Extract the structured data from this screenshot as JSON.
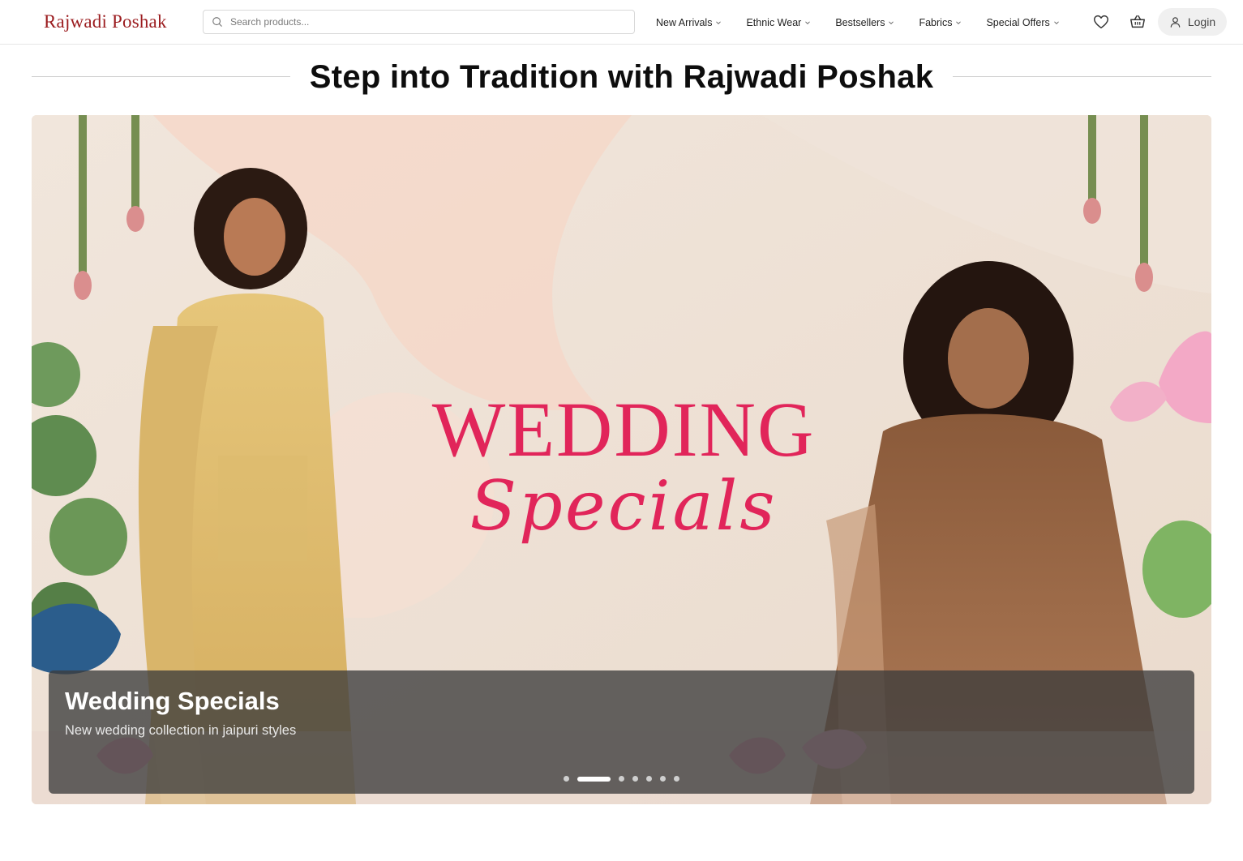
{
  "header": {
    "logo_text": "Rajwadi Poshak",
    "search": {
      "placeholder": "Search products...",
      "value": ""
    },
    "nav": [
      {
        "label": "New Arrivals"
      },
      {
        "label": "Ethnic Wear"
      },
      {
        "label": "Bestsellers"
      },
      {
        "label": "Fabrics"
      },
      {
        "label": "Special Offers"
      }
    ],
    "icons": [
      "heart-icon",
      "basket-icon",
      "user-icon",
      "search-icon",
      "chevron-down-icon"
    ],
    "login_label": "Login"
  },
  "page_title": "Step into Tradition with Rajwadi Poshak",
  "carousel": {
    "active_index": 1,
    "slide_count": 7,
    "banner_text_line1": "WEDDING",
    "banner_text_line2": "Specials",
    "caption_title": "Wedding Specials",
    "caption_subtitle": "New wedding collection in jaipuri styles"
  },
  "colors": {
    "brand": "#9b1c1f",
    "promo_pink": "#e1255a",
    "caption_overlay": "#3c3c3c"
  }
}
